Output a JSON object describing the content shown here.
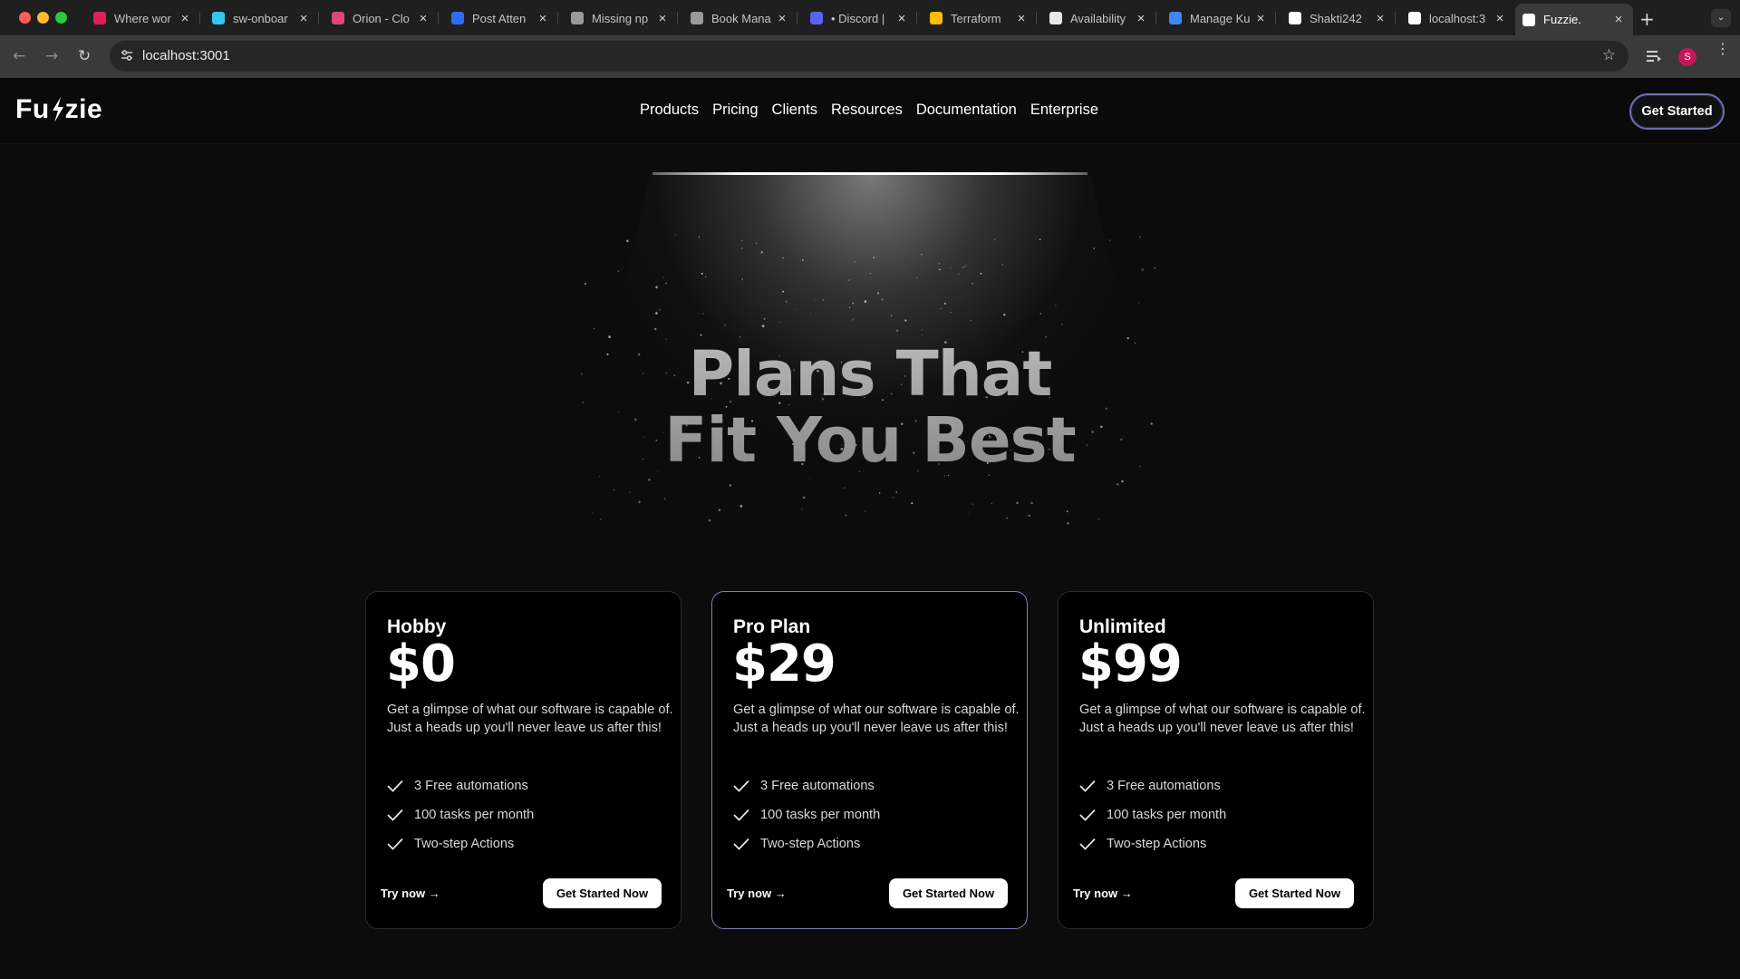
{
  "browser": {
    "tabs": [
      {
        "title": "Where wor",
        "favicon_color": "#e01e5a"
      },
      {
        "title": "sw-onboar",
        "favicon_color": "#36c5f0"
      },
      {
        "title": "Orion - Clo",
        "favicon_color": "#e0457b"
      },
      {
        "title": "Post Atten",
        "favicon_color": "#2d6cf6"
      },
      {
        "title": "Missing np",
        "favicon_color": "#9a9a9a"
      },
      {
        "title": "Book Mana",
        "favicon_color": "#9a9a9a"
      },
      {
        "title": "• Discord |",
        "favicon_color": "#5865f2"
      },
      {
        "title": "Terraform",
        "favicon_color": "#fbbc04"
      },
      {
        "title": "Availability",
        "favicon_color": "#e8e8e8"
      },
      {
        "title": "Manage Ku",
        "favicon_color": "#4285f4"
      },
      {
        "title": "Shakti242",
        "favicon_color": "#ffffff"
      },
      {
        "title": "localhost:3",
        "favicon_color": "#ffffff"
      },
      {
        "title": "Fuzzie.",
        "favicon_color": "#ffffff"
      }
    ],
    "address": "localhost:3001",
    "profile_initial": "S"
  },
  "site": {
    "logo_left": "Fu",
    "logo_right": "zie",
    "nav": [
      "Products",
      "Pricing",
      "Clients",
      "Resources",
      "Documentation",
      "Enterprise"
    ],
    "header_cta": "Get Started"
  },
  "hero": {
    "title_line1": "Plans That",
    "title_line2": "Fit You Best"
  },
  "plans": [
    {
      "name": "Hobby",
      "price": "$0",
      "description": "Get a glimpse of what our software is capable of. Just a heads up you'll never leave us after this!",
      "features": [
        "3 Free automations",
        "100 tasks per month",
        "Two-step Actions"
      ],
      "try_label": "Try now →",
      "cta_label": "Get Started Now",
      "featured": false
    },
    {
      "name": "Pro Plan",
      "price": "$29",
      "description": "Get a glimpse of what our software is capable of. Just a heads up you'll never leave us after this!",
      "features": [
        "3 Free automations",
        "100 tasks per month",
        "Two-step Actions"
      ],
      "try_label": "Try now →",
      "cta_label": "Get Started Now",
      "featured": true
    },
    {
      "name": "Unlimited",
      "price": "$99",
      "description": "Get a glimpse of what our software is capable of. Just a heads up you'll never leave us after this!",
      "features": [
        "3 Free automations",
        "100 tasks per month",
        "Two-step Actions"
      ],
      "try_label": "Try now →",
      "cta_label": "Get Started Now",
      "featured": false
    }
  ],
  "colors": {
    "featured_border": "#7e7fb8",
    "header_cta_border": "#6d6eb0"
  }
}
